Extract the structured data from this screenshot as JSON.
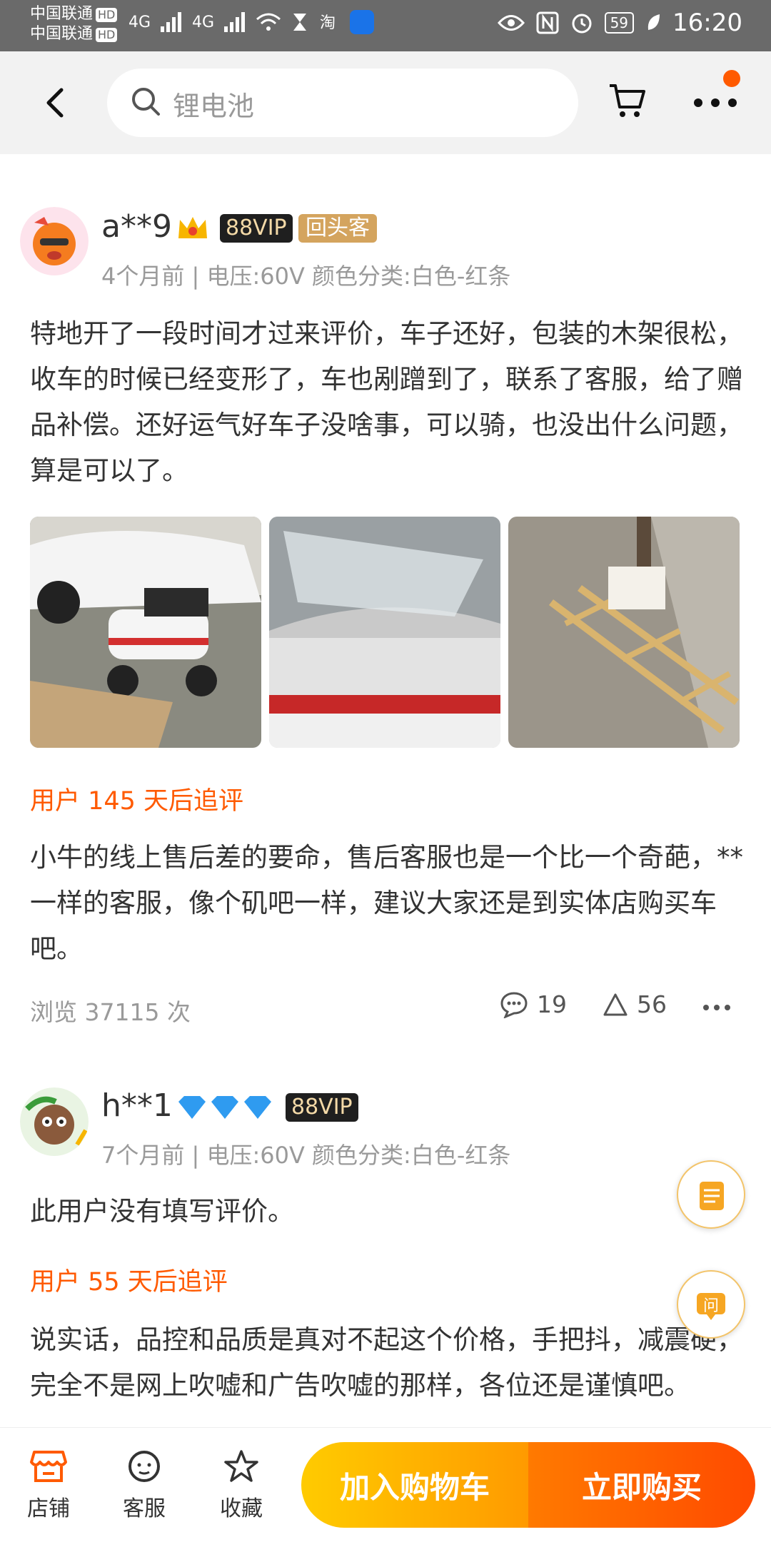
{
  "status_bar": {
    "carrier1": "中国联通",
    "carrier2": "中国联通",
    "hd": "HD",
    "network": "4G",
    "battery": "59",
    "time": "16:20"
  },
  "search": {
    "query": "锂电池"
  },
  "reviews": [
    {
      "username": "a**9",
      "vip": "88VIP",
      "repeat_badge": "回头客",
      "meta": "4个月前 | 电压:60V 颜色分类:白色-红条",
      "text": "特地开了一段时间才过来评价，车子还好，包装的木架很松，收车的时候已经变形了，车也剐蹭到了，联系了客服，给了赠品补偿。还好运气好车子没啥事，可以骑，也没出什么问题，算是可以了。",
      "followup_label": "用户 145 天后追评",
      "followup_text": "小牛的线上售后差的要命，售后客服也是一个比一个奇葩，**一样的客服，像个矶吧一样，建议大家还是到实体店购买车吧。",
      "views": "浏览 37115 次",
      "comments": "19",
      "likes": "56"
    },
    {
      "username": "h**1",
      "vip": "88VIP",
      "meta": "7个月前 | 电压:60V 颜色分类:白色-红条",
      "text": "此用户没有填写评价。",
      "followup_label": "用户 55 天后追评",
      "followup_text": "说实话，品控和品质是真对不起这个价格，手把抖，减震硬，完全不是网上吹嘘和广告吹嘘的那样，各位还是谨慎吧。"
    }
  ],
  "float_buttons": {
    "ask": "问"
  },
  "bottom_bar": {
    "store": "店铺",
    "service": "客服",
    "favorite": "收藏",
    "add_cart": "加入购物车",
    "buy_now": "立即购买"
  },
  "colors": {
    "accent": "#ff5a00",
    "gold": "#ffcb00"
  }
}
